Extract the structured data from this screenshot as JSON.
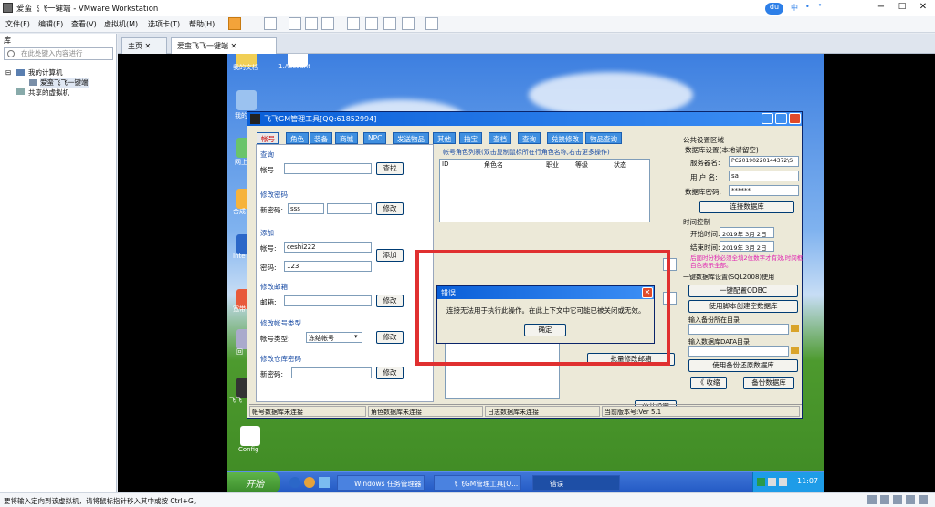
{
  "window": {
    "title": "爱蛮飞飞一键端 - VMware Workstation"
  },
  "topright": {
    "badge": "du",
    "items": [
      "中",
      "•",
      "°"
    ]
  },
  "menu": [
    "文件(F)",
    "编辑(E)",
    "查看(V)",
    "虚拟机(M)",
    "选项卡(T)",
    "帮助(H)"
  ],
  "library": {
    "title": "库",
    "search_placeholder": "在此处键入内容进行",
    "tree": [
      "我的计算机",
      "爱蛮飞飞一键端",
      "共享的虚拟机"
    ]
  },
  "tabs": [
    "主页",
    "爱蛮飞飞一键端"
  ],
  "desktop": {
    "icons": [
      "我的文档",
      "1.Account",
      "我的",
      "网上",
      "合成",
      "Inte Expl",
      "宽带",
      "回",
      "飞飞",
      "Config"
    ]
  },
  "app": {
    "title": "飞飞GM管理工具[QQ:61852994]",
    "tabs": [
      "帐号",
      "角色",
      "装备",
      "商城",
      "NPC",
      "发送物品",
      "其他",
      "抽宝",
      "查档",
      "查询",
      "兑换修改",
      "物品查询"
    ],
    "query": {
      "section": "查询",
      "label": "帐号",
      "button": "查找"
    },
    "change_pwd": {
      "section": "修改密码",
      "label": "新密码:",
      "value": "sss",
      "button": "修改"
    },
    "add": {
      "section": "添加",
      "acct_label": "帐号:",
      "acct_value": "ceshi222",
      "pwd_label": "密码:",
      "pwd_value": "123",
      "button": "添加"
    },
    "mail": {
      "section": "修改邮箱",
      "label": "邮箱:",
      "button": "修改"
    },
    "acct_type": {
      "section": "修改帐号类型",
      "label": "帐号类型:",
      "value": "冻结帐号",
      "button": "修改"
    },
    "bank_pwd": {
      "section": "修改仓库密码",
      "label": "新密码:",
      "button": "修改"
    },
    "roles": {
      "header": "帐号角色列表(双击复制鼠标所在行角色名称,右击更多操作)",
      "columns": [
        "ID",
        "角色名",
        "职业",
        "等级",
        "状态"
      ]
    },
    "batch_mail": "批量修改邮箱",
    "public_settings": "公共设置",
    "right": {
      "section": "公共设置区域",
      "db_title": "数据库设置(本地请留空)",
      "server_label": "服务器名:",
      "server_value": "PC20190220144372\\S",
      "user_label": "用 户 名:",
      "user_value": "sa",
      "pwd_label": "数据库密码:",
      "pwd_value": "******",
      "connect": "连接数据库",
      "time_title": "时间控制",
      "start_label": "开始时间:",
      "start_value": "2019年 3月 2日",
      "end_label": "结束时间:",
      "end_value": "2019年 3月 2日",
      "note": "后面时分秒必须全填2位数字才有效,时间框白色表示全部。",
      "oneclick_title": "一键数据库设置(SQL2008)使用",
      "odbc": "一键配置ODBC",
      "script_btn": "使用脚本创建空数据库",
      "backup_label": "输入备份所在目录",
      "data_label": "输入数据库DATA目录",
      "restore_btn": "使用备份还原数据库",
      "collapse_btn": "《 收缩",
      "backup_btn": "备份数据库"
    },
    "status": [
      "帐号数据库未连接",
      "角色数据库未连接",
      "日志数据库未连接",
      "当前版本号:Ver 5.1"
    ]
  },
  "dialog": {
    "title": "错误",
    "message": "连接无法用于执行此操作。在此上下文中它可能已被关闭或无效。",
    "ok": "确定"
  },
  "taskbar": {
    "start": "开始",
    "items": [
      "Windows 任务管理器",
      "飞飞GM管理工具[Q...",
      "错误"
    ],
    "time": "11:07"
  },
  "statusbar": "要将输入定向到该虚拟机，请将鼠标指针移入其中或按 Ctrl+G。"
}
